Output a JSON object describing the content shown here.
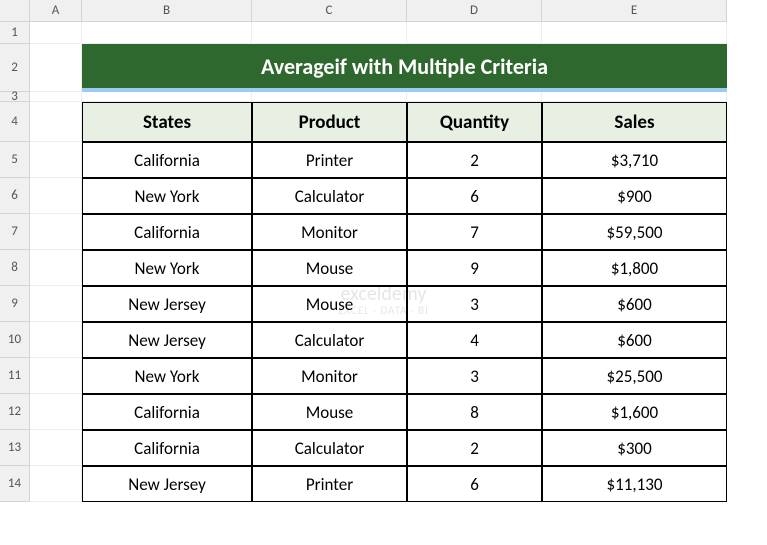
{
  "columns": [
    "A",
    "B",
    "C",
    "D",
    "E"
  ],
  "rowCount": 14,
  "title": "Averageif with Multiple Criteria",
  "headers": {
    "states": "States",
    "product": "Product",
    "quantity": "Quantity",
    "sales": "Sales"
  },
  "chart_data": {
    "type": "table",
    "title": "Averageif with Multiple Criteria",
    "columns": [
      "States",
      "Product",
      "Quantity",
      "Sales"
    ],
    "rows": [
      {
        "states": "California",
        "product": "Printer",
        "quantity": 2,
        "sales": "$3,710"
      },
      {
        "states": "New York",
        "product": "Calculator",
        "quantity": 6,
        "sales": "$900"
      },
      {
        "states": "California",
        "product": "Monitor",
        "quantity": 7,
        "sales": "$59,500"
      },
      {
        "states": "New York",
        "product": "Mouse",
        "quantity": 9,
        "sales": "$1,800"
      },
      {
        "states": "New Jersey",
        "product": "Mouse",
        "quantity": 3,
        "sales": "$600"
      },
      {
        "states": "New Jersey",
        "product": "Calculator",
        "quantity": 4,
        "sales": "$600"
      },
      {
        "states": "New York",
        "product": "Monitor",
        "quantity": 3,
        "sales": "$25,500"
      },
      {
        "states": "California",
        "product": "Mouse",
        "quantity": 8,
        "sales": "$1,600"
      },
      {
        "states": "California",
        "product": "Calculator",
        "quantity": 2,
        "sales": "$300"
      },
      {
        "states": "New Jersey",
        "product": "Printer",
        "quantity": 6,
        "sales": "$11,130"
      }
    ]
  },
  "watermark": {
    "main": "exceldemy",
    "sub": "EXCEL · DATA · BI"
  }
}
